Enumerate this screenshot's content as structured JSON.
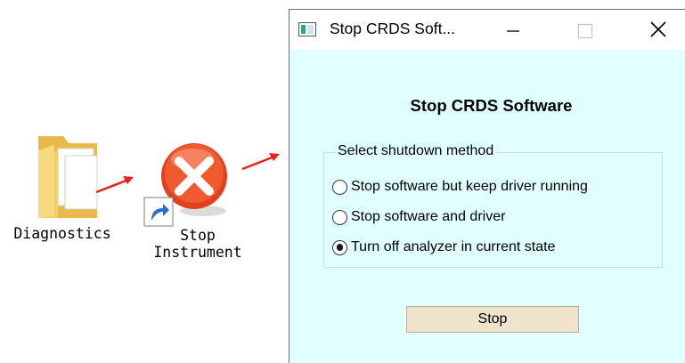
{
  "desktop": {
    "diagnostics_label": "Diagnostics",
    "stop_instrument_label_line1": "Stop",
    "stop_instrument_label_line2": "Instrument"
  },
  "window": {
    "title": "Stop CRDS Soft...",
    "heading": "Stop CRDS Software",
    "group_label": "Select shutdown method",
    "options": [
      {
        "label": "Stop software but keep driver running",
        "selected": false
      },
      {
        "label": "Stop software and driver",
        "selected": false
      },
      {
        "label": "Turn off analyzer in current state",
        "selected": true
      }
    ],
    "stop_button_label": "Stop"
  },
  "colors": {
    "client_background": "#e0ffff",
    "arrow": "#e8201c",
    "button_background": "#efe4cb",
    "folder": "#f3cf6a",
    "stop_icon": "#e8482a"
  },
  "icons": [
    "folder-icon",
    "stop-icon",
    "shortcut-arrow-icon",
    "app-icon",
    "minimize-icon",
    "maximize-icon",
    "close-icon"
  ]
}
